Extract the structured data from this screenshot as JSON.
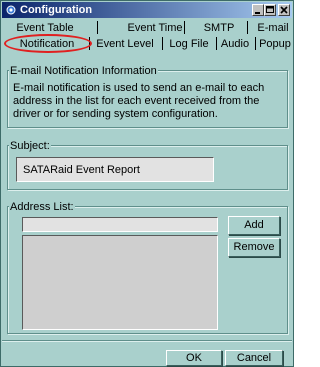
{
  "window": {
    "title": "Configuration",
    "icon": "app-gear-icon",
    "controls": [
      "minimize-icon",
      "maximize-icon",
      "close-icon"
    ],
    "title_gradient": [
      "#0a246a",
      "#a6caf0"
    ]
  },
  "tabs": {
    "row1": [
      "Event Table",
      "Event Time",
      "SMTP",
      "E-mail"
    ],
    "row2": [
      "Notification",
      "Event Level",
      "Log File",
      "Audio",
      "Popup"
    ],
    "selected": "Notification",
    "highlight_color": "#e02020"
  },
  "info_group": {
    "legend": "E-mail Notification Information",
    "text": "E-mail notification is used to send an e-mail to each address in the list for each event received from the driver or for sending system configuration."
  },
  "subject_group": {
    "legend": "Subject:",
    "value": "SATARaid Event Report"
  },
  "address_group": {
    "legend": "Address List:",
    "input_value": "",
    "add_label": "Add",
    "remove_label": "Remove"
  },
  "footer": {
    "ok_label": "OK",
    "cancel_label": "Cancel"
  },
  "colors": {
    "background": "#a9d0cc",
    "field": "#e2e2e2",
    "list": "#cfcfcf"
  }
}
